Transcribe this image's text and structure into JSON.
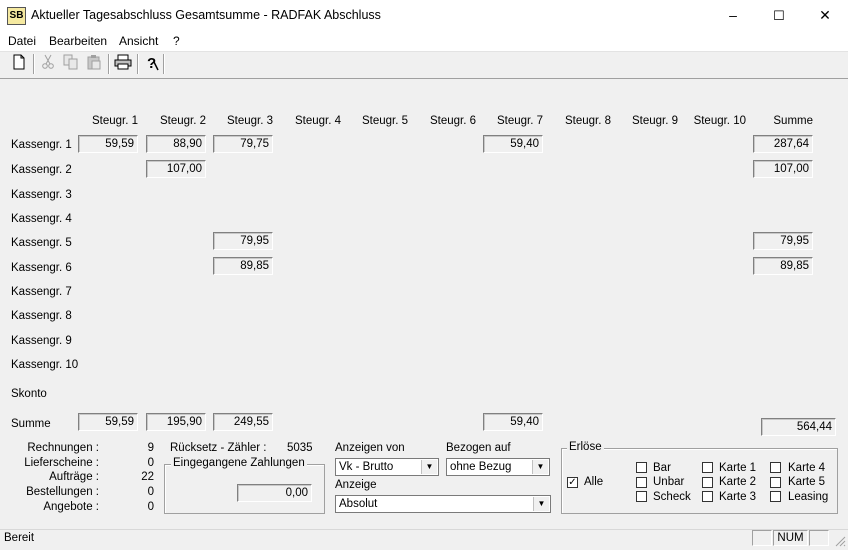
{
  "window": {
    "title": "Aktueller Tagesabschluss Gesamtsumme - RADFAK Abschluss",
    "app_icon": "SB",
    "minimize": "–",
    "maximize": "☐",
    "close": "✕"
  },
  "menu": {
    "items": [
      "Datei",
      "Bearbeiten",
      "Ansicht",
      "?"
    ]
  },
  "toolbar": {
    "new_icon": "new-document-icon",
    "cut_icon": "cut-icon",
    "copy_icon": "copy-icon",
    "paste_icon": "paste-icon",
    "print_icon": "print-icon",
    "help_icon": "help-icon"
  },
  "grid": {
    "columns": [
      "Steugr. 1",
      "Steugr. 2",
      "Steugr. 3",
      "Steugr. 4",
      "Steugr. 5",
      "Steugr. 6",
      "Steugr. 7",
      "Steugr. 8",
      "Steugr. 9",
      "Steugr. 10",
      "Summe"
    ],
    "rows": [
      "Kassengr. 1",
      "Kassengr. 2",
      "Kassengr. 3",
      "Kassengr. 4",
      "Kassengr. 5",
      "Kassengr. 6",
      "Kassengr. 7",
      "Kassengr. 8",
      "Kassengr. 9",
      "Kassengr. 10"
    ],
    "skonto_label": "Skonto",
    "summe_label": "Summe",
    "values": {
      "r1_c1": "59,59",
      "r1_c2": "88,90",
      "r1_c3": "79,75",
      "r1_c7": "59,40",
      "r1_sum": "287,64",
      "r2_c2": "107,00",
      "r2_sum": "107,00",
      "r5_c3": "79,95",
      "r5_sum": "79,95",
      "r6_c3": "89,85",
      "r6_sum": "89,85",
      "total_c1": "59,59",
      "total_c2": "195,90",
      "total_c3": "249,55",
      "total_c7": "59,40",
      "grand_total": "564,44"
    }
  },
  "stats": {
    "rechnungen_label": "Rechnungen :",
    "rechnungen": "9",
    "lieferscheine_label": "Lieferscheine :",
    "lieferscheine": "0",
    "auftraege_label": "Aufträge :",
    "auftraege": "22",
    "bestellungen_label": "Bestellungen :",
    "bestellungen": "0",
    "angebote_label": "Angebote :",
    "angebote": "0",
    "ruecksetz_label": "Rücksetz - Zähler :",
    "ruecksetz": "5035"
  },
  "zahlungen": {
    "title": "Eingegangene Zahlungen",
    "value": "0,00"
  },
  "options": {
    "anzeigen_von_label": "Anzeigen von",
    "anzeigen_von_value": "Vk - Brutto",
    "bezogen_auf_label": "Bezogen auf",
    "bezogen_auf_value": "ohne Bezug",
    "anzeige_label": "Anzeige",
    "anzeige_value": "Absolut",
    "dropdown_icon": "chevron-down-icon"
  },
  "erloese": {
    "title": "Erlöse",
    "alle": "Alle",
    "alle_checked": true,
    "checkboxes": [
      "Bar",
      "Unbar",
      "Scheck",
      "Karte 1",
      "Karte 2",
      "Karte 3",
      "Karte 4",
      "Karte 5",
      "Leasing"
    ]
  },
  "statusbar": {
    "text": "Bereit",
    "num": "NUM"
  }
}
